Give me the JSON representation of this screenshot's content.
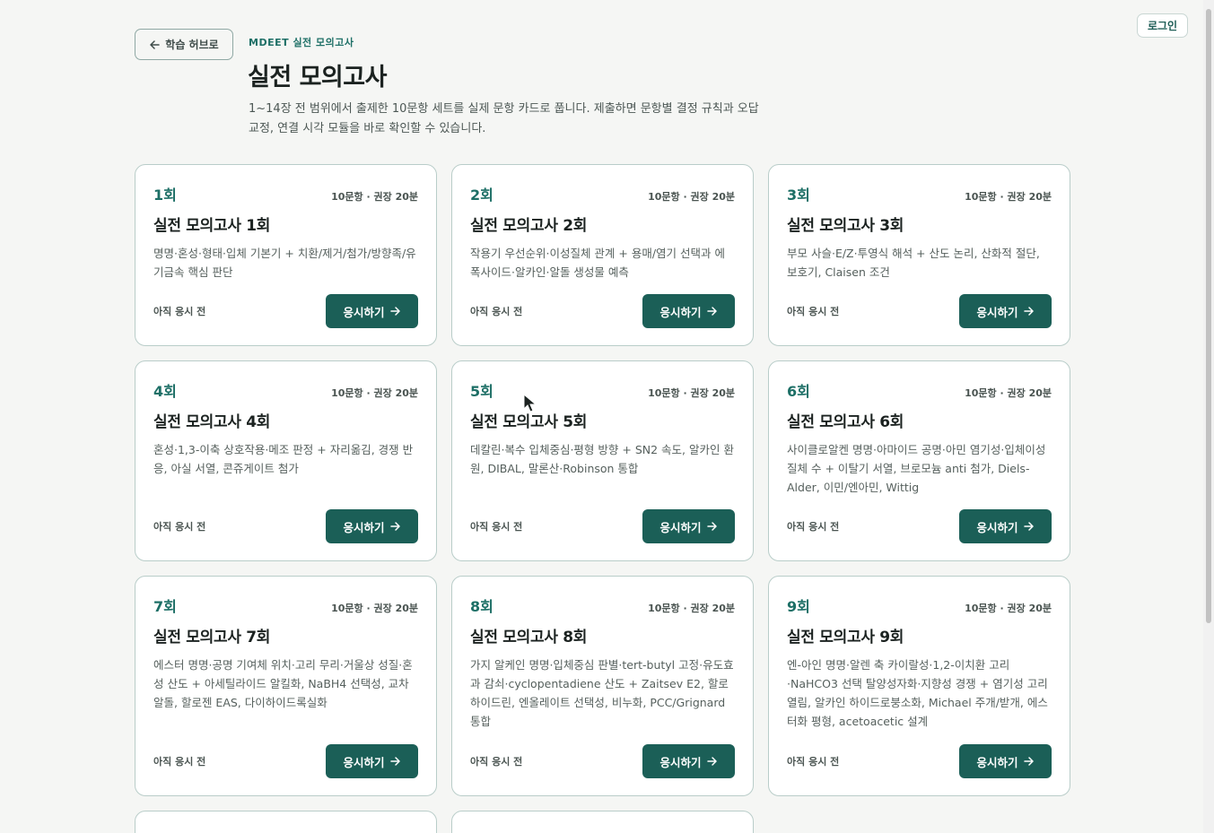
{
  "header": {
    "login_label": "로그인",
    "back_label": "학습 허브로",
    "back_icon": "arrow-left-icon",
    "eyebrow": "MDEET 실전 모의고사",
    "title": "실전 모의고사",
    "description": "1~14장 전 범위에서 출제한 10문항 세트를 실제 문항 카드로 풉니다. 제출하면 문항별 결정 규칙과 오답 교정, 연결 시각 모듈을 바로 확인할 수 있습니다."
  },
  "cards": [
    {
      "num": "1회",
      "meta": "10문항 · 권장 20분",
      "title": "실전 모의고사 1회",
      "desc": "명명·혼성·형태·입체 기본기 + 치환/제거/첨가/방향족/유기금속 핵심 판단",
      "status": "아직 응시 전",
      "button": "응시하기"
    },
    {
      "num": "2회",
      "meta": "10문항 · 권장 20분",
      "title": "실전 모의고사 2회",
      "desc": "작용기 우선순위·이성질체 관계 + 용매/염기 선택과 에폭사이드·알카인·알돌 생성물 예측",
      "status": "아직 응시 전",
      "button": "응시하기"
    },
    {
      "num": "3회",
      "meta": "10문항 · 권장 20분",
      "title": "실전 모의고사 3회",
      "desc": "부모 사슬·E/Z·투영식 해석 + 산도 논리, 산화적 절단, 보호기, Claisen 조건",
      "status": "아직 응시 전",
      "button": "응시하기"
    },
    {
      "num": "4회",
      "meta": "10문항 · 권장 20분",
      "title": "실전 모의고사 4회",
      "desc": "혼성·1,3-이축 상호작용·메조 판정 + 자리옮김, 경쟁 반응, 아실 서열, 콘쥬게이트 첨가",
      "status": "아직 응시 전",
      "button": "응시하기"
    },
    {
      "num": "5회",
      "meta": "10문항 · 권장 20분",
      "title": "실전 모의고사 5회",
      "desc": "데칼린·복수 입체중심·평형 방향 + SN2 속도, 알카인 환원, DIBAL, 말론산·Robinson 통합",
      "status": "아직 응시 전",
      "button": "응시하기"
    },
    {
      "num": "6회",
      "meta": "10문항 · 권장 20분",
      "title": "실전 모의고사 6회",
      "desc": "사이클로알켄 명명·아마이드 공명·아민 염기성·입체이성질체 수 + 이탈기 서열, 브로모늄 anti 첨가, Diels-Alder, 이민/엔아민, Wittig",
      "status": "아직 응시 전",
      "button": "응시하기"
    },
    {
      "num": "7회",
      "meta": "10문항 · 권장 20분",
      "title": "실전 모의고사 7회",
      "desc": "에스터 명명·공명 기여체 위치·고리 무리·거울상 성질·혼성 산도 + 아세틸라이드 알킬화, NaBH4 선택성, 교차 알돌, 할로젠 EAS, 다이하이드록실화",
      "status": "아직 응시 전",
      "button": "응시하기"
    },
    {
      "num": "8회",
      "meta": "10문항 · 권장 20분",
      "title": "실전 모의고사 8회",
      "desc": "가지 알케인 명명·입체중심 판별·tert-butyl 고정·유도효과 감쇠·cyclopentadiene 산도 + Zaitsev E2, 할로하이드린, 엔올레이트 선택성, 비누화, PCC/Grignard 통합",
      "status": "아직 응시 전",
      "button": "응시하기"
    },
    {
      "num": "9회",
      "meta": "10문항 · 권장 20분",
      "title": "실전 모의고사 9회",
      "desc": "엔-아인 명명·알렌 축 카이랄성·1,2-이치환 고리·NaHCO3 선택 탈양성자화·지향성 경쟁 + 염기성 고리열림, 알카인 하이드로붕소화, Michael 주개/받개, 에스터화 평형, acetoacetic 설계",
      "status": "아직 응시 전",
      "button": "응시하기"
    }
  ]
}
